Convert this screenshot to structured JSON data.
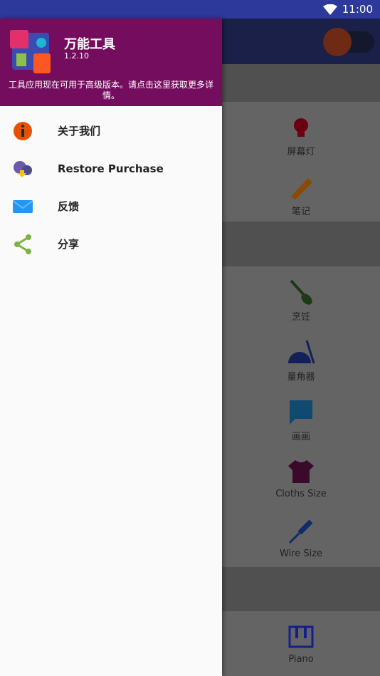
{
  "status_bar": {
    "time": "11:00"
  },
  "drawer": {
    "app_name": "万能工具",
    "version": "1.2.10",
    "promo": "工具应用现在可用于高级版本。请点击这里获取更多详情。",
    "menu": [
      {
        "label": "关于我们",
        "icon": "info-icon"
      },
      {
        "label": "Restore Purchase",
        "icon": "cloud-download-icon"
      },
      {
        "label": "反馈",
        "icon": "mail-icon"
      },
      {
        "label": "分享",
        "icon": "share-icon"
      }
    ]
  },
  "tools": [
    {
      "label": "屏幕灯",
      "icon": "bulb-icon",
      "color": "#6a0010"
    },
    {
      "label": "笔记",
      "icon": "pencil-icon",
      "color": "#8a4a00"
    },
    {
      "label": "烹饪",
      "icon": "spatula-icon",
      "color": "#1e3a14"
    },
    {
      "label": "量角器",
      "icon": "protractor-icon",
      "color": "#14205a"
    },
    {
      "label": "画画",
      "icon": "drawing-icon",
      "color": "#104a70"
    },
    {
      "label": "Cloths Size",
      "icon": "shirt-icon",
      "color": "#3a0a2a"
    },
    {
      "label": "Wire Size",
      "icon": "screwdriver-icon",
      "color": "#102a6a"
    },
    {
      "label": "Piano",
      "icon": "piano-icon",
      "color": "#14208a"
    }
  ]
}
